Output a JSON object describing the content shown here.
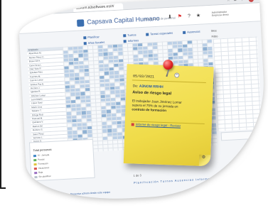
{
  "browser": {
    "tab_title": "a3nom.a3software.es/#/",
    "icons": "☆ ⧉ ⋮"
  },
  "app": {
    "title": "Capsava Capital Humano",
    "subtitle": "Planificación de personal",
    "header_icons": [
      "⬇",
      "⚑",
      "?",
      "★"
    ],
    "user_line1": "Administrador",
    "user_line2": "Empresa demo"
  },
  "toolbar": {
    "items": [
      "Planificar",
      "Turnos",
      "Tareas especiales",
      "Ausencias",
      "Años fiscales",
      "Informes"
    ],
    "selector_value": "Mes",
    "filter_label": "Filtro"
  },
  "sticky_note": {
    "date": "05/03/2021",
    "to_prefix": "De:",
    "to_value": "A3NOM RRHH",
    "subject": "Aviso de riesgo legal",
    "body_part1": "El trabajador Juan Jiménez Lomar",
    "body_part2": "supera el 75% de su jornada en",
    "body_strong": "contrato de formación",
    "link_text": "Informe de riesgo legal - Revisar",
    "close_symbol": "×",
    "tool_icon": "⚙"
  },
  "left_list": {
    "header": "Empleado",
    "rows": [
      "Abad Ruiz M.",
      "Alonso Pérez C.",
      "Bravo Gil A.",
      "Cano Vera L.",
      "Díaz Soto P.",
      "Esteban Ríos",
      "Fuentes M.",
      "García Lomar",
      "Gómez Paz E.",
      "Herrera J.",
      "Iglesias R.",
      "Jiménez Lomar",
      "León Martín",
      "López Sanz",
      "Marín Cruz",
      "Navarro T.",
      "Ortega Ruiz",
      "Pascual M.",
      "Quintana V.",
      "Ramos Gil",
      "Romero S.",
      "Sáez Pérez",
      "Serrano L.",
      "Torres D.",
      "Vidal N."
    ]
  },
  "summary": {
    "label": "Total personas",
    "legend": [
      {
        "label": "Sí - Jornada",
        "color": "#3f86c6"
      },
      {
        "label": "Parcial",
        "color": "#5fb35b"
      },
      {
        "label": "Formación",
        "color": "#e0c33a"
      },
      {
        "label": "Vacaciones",
        "color": "#d9544f"
      },
      {
        "label": "Baja",
        "color": "#9b6fc2"
      },
      {
        "label": "Sin planificar",
        "color": "#b8c2cc"
      }
    ]
  },
  "footer": {
    "links": "Planificación Turnos Ausencias Informes Configuración",
    "status": "Presentar a3nom desde este equipo",
    "page": "1 de 3"
  },
  "colors": {
    "accent": "#3a5f9c",
    "note": "#f0dc4a",
    "pin": "#e02424"
  }
}
